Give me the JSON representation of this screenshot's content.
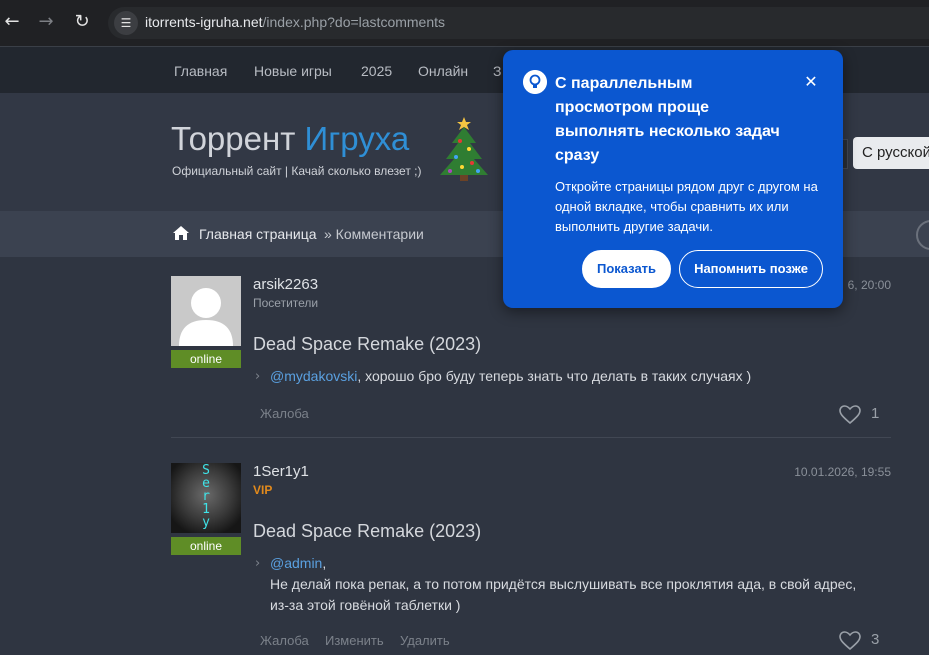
{
  "browser": {
    "url_host": "itorrents-igruha.net",
    "url_path": "/index.php?do=lastcomments",
    "back_icon": "arrow-left",
    "forward_icon": "arrow-right",
    "reload_icon": "reload",
    "site_info_icon": "tune"
  },
  "nav": {
    "items": [
      "Главная",
      "Новые игры",
      "2025",
      "Онлайн",
      "З"
    ]
  },
  "header": {
    "title_part1": "Торрент",
    "title_part2": "Игруха",
    "subtitle": "Официальный сайт | Качай сколько влезет ;)",
    "lang_select_value": "С русской"
  },
  "breadcrumb": {
    "home": "Главная страница",
    "current": "» Комментарии"
  },
  "comments": [
    {
      "username": "arsik2263",
      "group": "Посетители",
      "date": "6, 20:00",
      "status": "online",
      "game": "Dead Space Remake (2023)",
      "mention": "@mydakovski",
      "text": ", хорошо бро буду теперь знать что делать в таких случаях )",
      "actions": [
        "Жалоба"
      ],
      "likes": "1"
    },
    {
      "username": "1Ser1y1",
      "group": "VIP",
      "date": "10.01.2026, 19:55",
      "status": "online",
      "avatar_text": "Ser1y",
      "game": "Dead Space Remake (2023)",
      "mention": "@admin",
      "mention_suffix": ",",
      "text": "Не делай пока репак, а то потом придётся выслушивать все проклятия ада, в свой адрес, из-за этой говёной таблетки )",
      "actions": [
        "Жалоба",
        "Изменить",
        "Удалить"
      ],
      "likes": "3"
    }
  ],
  "popup": {
    "title": "С параллельным просмотром проще выполнять несколько задач сразу",
    "body": "Откройте страницы рядом друг с другом на одной вкладке, чтобы сравнить их или выполнить другие задачи.",
    "primary_button": "Показать",
    "secondary_button": "Напомнить позже",
    "colors": {
      "background": "#0b57d0",
      "text": "#ffffff"
    }
  },
  "colors": {
    "page_bg": "#2f3541",
    "accent_blue": "#2f8fd6",
    "online_green": "#5f8d26",
    "vip_orange": "#e28a1c"
  }
}
